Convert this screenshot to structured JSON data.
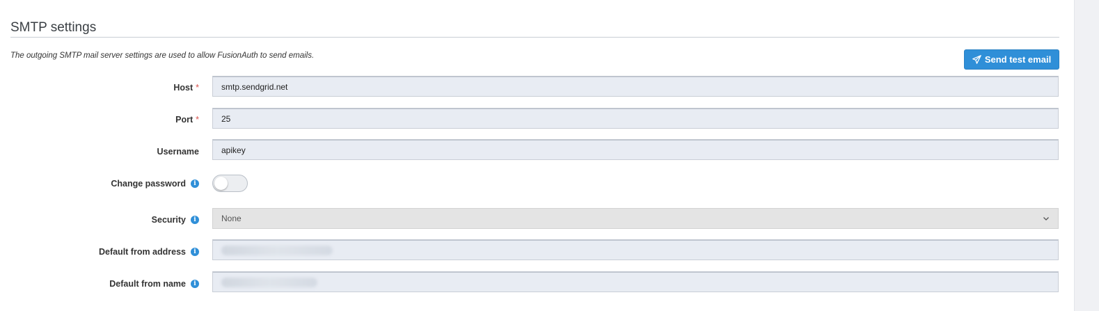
{
  "section": {
    "title": "SMTP settings",
    "description": "The outgoing SMTP mail server settings are used to allow FusionAuth to send emails."
  },
  "send_test_button": {
    "label": "Send test email",
    "icon": "paper-plane-icon"
  },
  "form": {
    "host": {
      "label": "Host",
      "required_mark": "*",
      "value": "smtp.sendgrid.net"
    },
    "port": {
      "label": "Port",
      "required_mark": "*",
      "value": "25"
    },
    "username": {
      "label": "Username",
      "value": "apikey"
    },
    "change_password": {
      "label": "Change password",
      "info_glyph": "i",
      "enabled": false
    },
    "security": {
      "label": "Security",
      "info_glyph": "i",
      "selected": "None"
    },
    "default_from_address": {
      "label": "Default from address",
      "info_glyph": "i"
    },
    "default_from_name": {
      "label": "Default from name",
      "info_glyph": "i"
    }
  },
  "colors": {
    "accent": "#2f8fd8",
    "required": "#d9534f",
    "field_bg": "#e8ecf3",
    "select_bg": "#e4e4e4"
  }
}
